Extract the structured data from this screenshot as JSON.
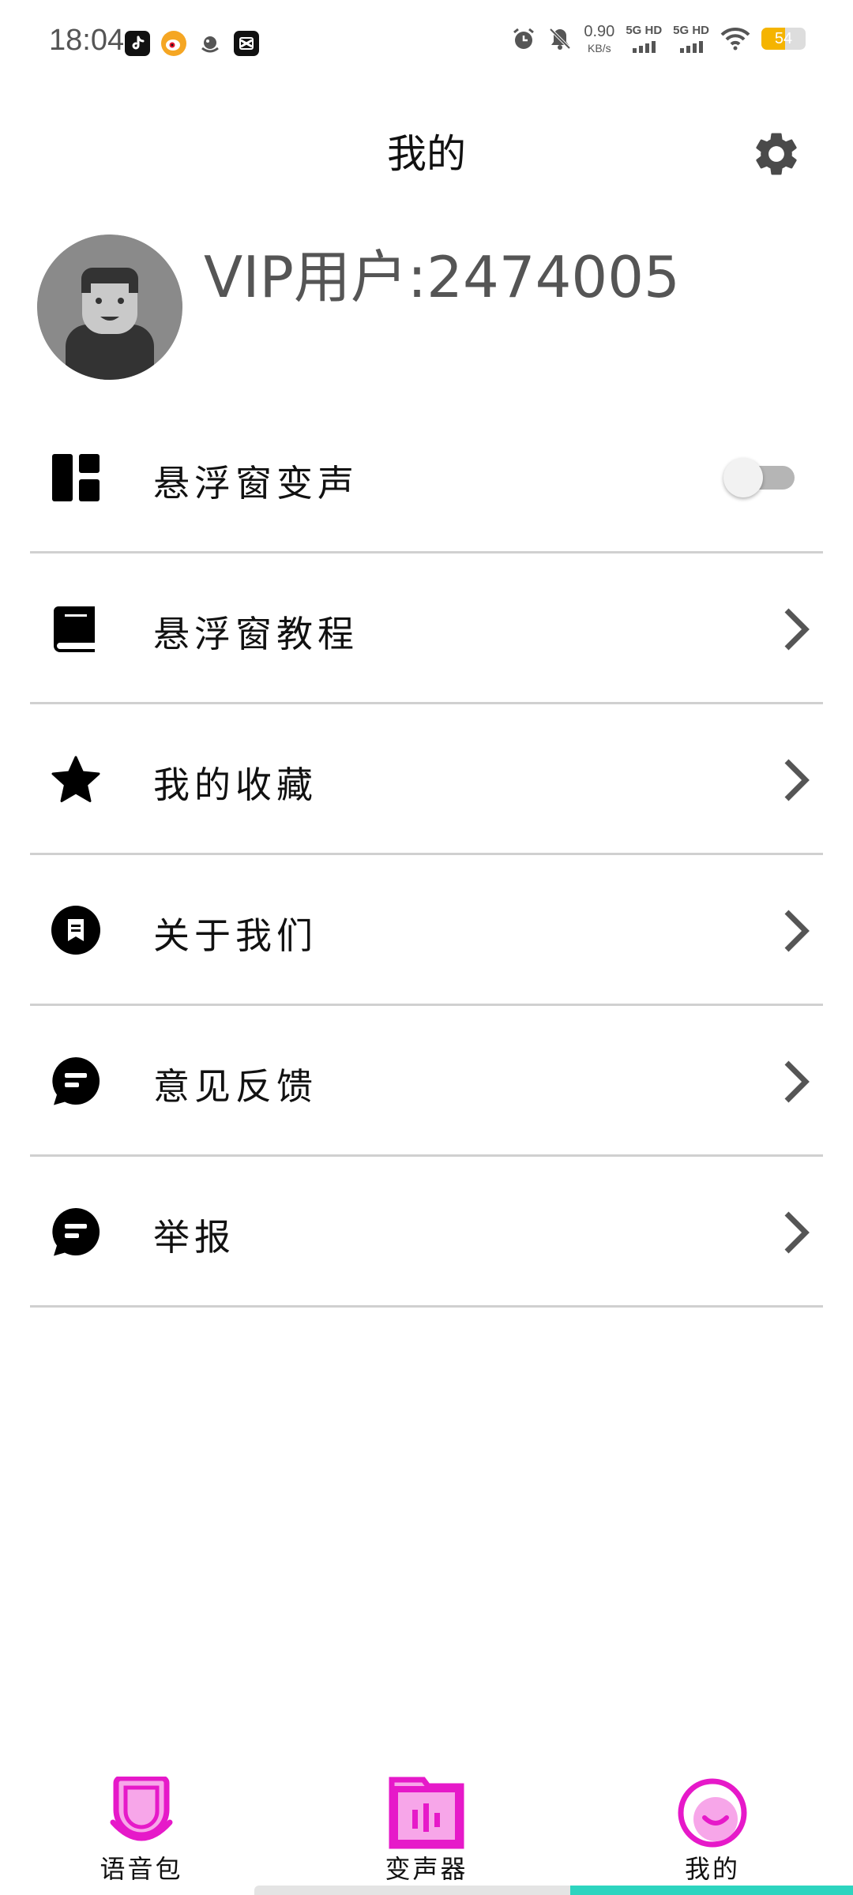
{
  "status_bar": {
    "time": "18:04",
    "net_speed_value": "0.90",
    "net_speed_unit": "KB/s",
    "sim1_label": "5G HD",
    "sim2_label": "5G HD",
    "battery_level": "54",
    "battery_fraction": 0.54,
    "app_icons": [
      "douyin-icon",
      "weibo-icon",
      "qq-icon",
      "capcut-icon"
    ],
    "system_icons": [
      "alarm-icon",
      "mute-bell-icon",
      "signal-icon",
      "wifi-icon",
      "battery-icon"
    ]
  },
  "header": {
    "title": "我的",
    "settings_icon": "gear-icon"
  },
  "profile": {
    "username": "VIP用户:2474005",
    "avatar_icon": "person-avatar"
  },
  "menu": {
    "items": [
      {
        "label": "悬浮窗变声",
        "icon": "dashboard-icon",
        "control": "toggle",
        "toggle_on": false
      },
      {
        "label": "悬浮窗教程",
        "icon": "book-icon",
        "control": "arrow"
      },
      {
        "label": "我的收藏",
        "icon": "star-icon",
        "control": "arrow"
      },
      {
        "label": "关于我们",
        "icon": "info-bookmark-icon",
        "control": "arrow"
      },
      {
        "label": "意见反馈",
        "icon": "chat-bubble-icon",
        "control": "arrow"
      },
      {
        "label": "举报",
        "icon": "chat-bubble-icon",
        "control": "arrow"
      }
    ]
  },
  "bottom_nav": {
    "items": [
      {
        "label": "语音包",
        "icon": "voice-pack-icon"
      },
      {
        "label": "变声器",
        "icon": "voice-changer-icon"
      },
      {
        "label": "我的",
        "icon": "smile-profile-icon"
      }
    ],
    "accent_color": "#e619c9",
    "accent_light": "#f7a6e9"
  }
}
